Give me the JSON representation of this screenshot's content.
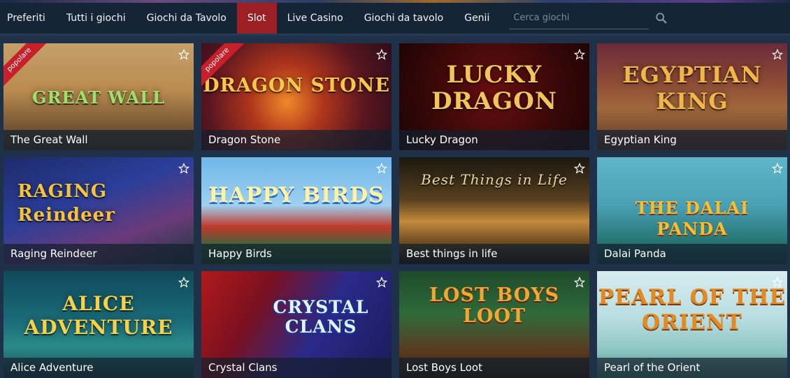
{
  "nav": {
    "tabs": [
      {
        "label": "Preferiti"
      },
      {
        "label": "Tutti i giochi"
      },
      {
        "label": "Giochi da Tavolo"
      },
      {
        "label": "Slot"
      },
      {
        "label": "Live Casino"
      },
      {
        "label": "Giochi da tavolo"
      },
      {
        "label": "Genii"
      }
    ],
    "active_tab": "Slot",
    "search_placeholder": "Cerca giochi"
  },
  "games": [
    {
      "title": "The Great Wall",
      "logo": "GREAT WALL",
      "badge": "popolare"
    },
    {
      "title": "Dragon Stone",
      "logo": "DRAGON STONE",
      "badge": "popolare"
    },
    {
      "title": "Lucky Dragon",
      "logo": "LUCKY DRAGON"
    },
    {
      "title": "Egyptian King",
      "logo": "EGYPTIAN KING"
    },
    {
      "title": "Raging Reindeer",
      "logo": "RAGING Reindeer"
    },
    {
      "title": "Happy Birds",
      "logo": "HAPPY BIRDS"
    },
    {
      "title": "Best things in life",
      "logo": "Best Things in Life"
    },
    {
      "title": "Dalai Panda",
      "logo": "THE DALAI PANDA"
    },
    {
      "title": "Alice Adventure",
      "logo": "ALICE ADVENTURE"
    },
    {
      "title": "Crystal Clans",
      "logo": "CRYSTAL CLANS"
    },
    {
      "title": "Lost Boys Loot",
      "logo": "LOST BOYS LOOT"
    },
    {
      "title": "Pearl of the Orient",
      "logo": "PEARL OF THE ORIENT"
    }
  ],
  "colors": {
    "active_tab": "#9b1f23",
    "navbar": "#152437",
    "page_bg": "#1f3149",
    "ribbon": "#c8202a"
  }
}
